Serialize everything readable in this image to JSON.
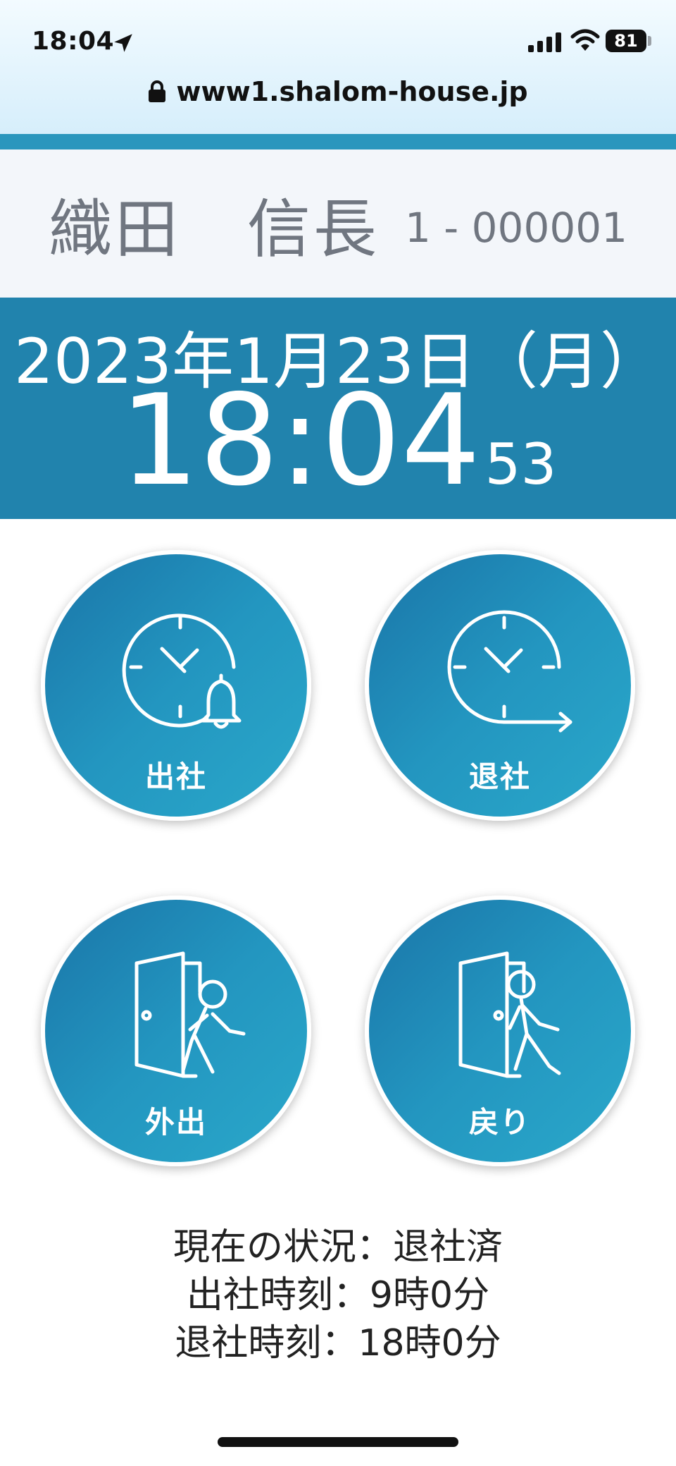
{
  "status_bar": {
    "time": "18:04",
    "battery": "81",
    "icons": [
      "location-arrow-icon",
      "cellular-signal-icon",
      "wifi-icon",
      "battery-icon"
    ]
  },
  "browser": {
    "url": "www1.shalom-house.jp",
    "icon": "lock-icon"
  },
  "employee": {
    "name": "織田　信長",
    "id": "1 - 000001"
  },
  "clock": {
    "date": "2023年1月23日（月）",
    "time": "18:04",
    "seconds": "53"
  },
  "buttons": [
    {
      "label": "出社",
      "icon": "clock-bell-icon"
    },
    {
      "label": "退社",
      "icon": "clock-arrow-icon"
    },
    {
      "label": "外出",
      "icon": "door-exit-icon"
    },
    {
      "label": "戻り",
      "icon": "door-return-icon"
    }
  ],
  "status": {
    "current": "現在の状況：退社済",
    "clock_in": "出社時刻：9時0分",
    "clock_out": "退社時刻：18時0分"
  },
  "colors": {
    "accent": "#2a96bd",
    "header_band": "#2183ad",
    "button_gradient_start": "#1a75a8",
    "button_gradient_end": "#2aa8ca"
  }
}
